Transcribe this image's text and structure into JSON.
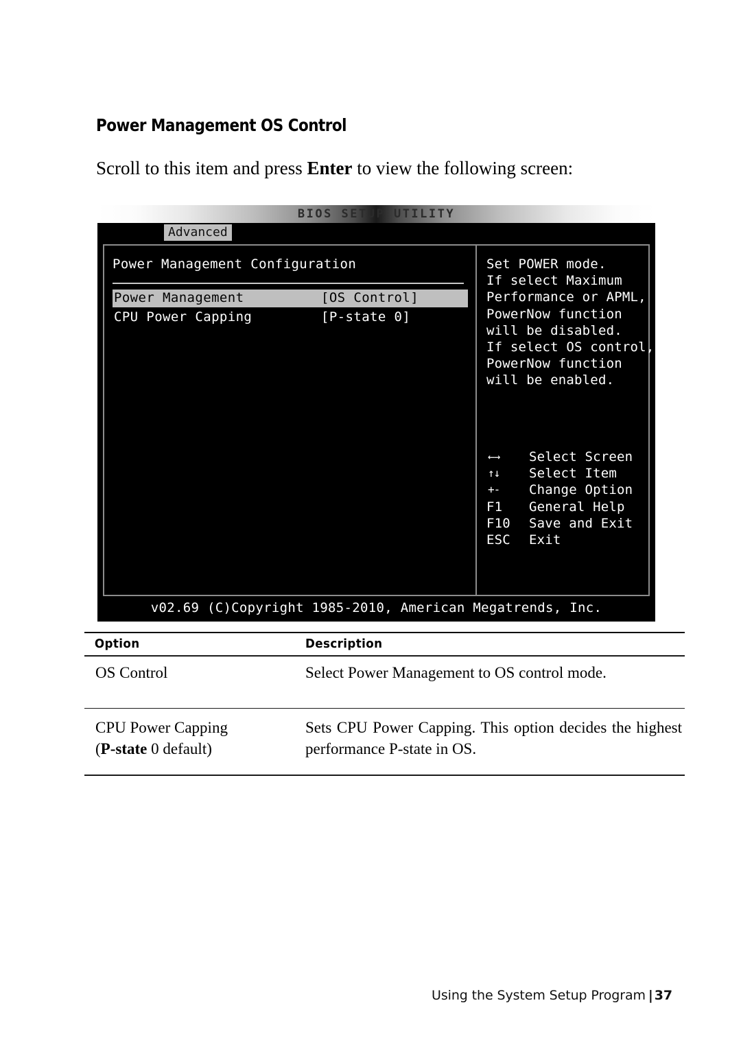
{
  "document": {
    "heading": "Power Management OS Control",
    "intro_prefix": "Scroll to this item and press ",
    "intro_bold": "Enter",
    "intro_suffix": " to view the following screen:"
  },
  "bios": {
    "title": "BIOS SETUP UTILITY",
    "active_tab": "Advanced",
    "config_title": "Power Management Configuration",
    "rows": [
      {
        "label": "Power Management",
        "value": "[OS Control]",
        "selected": true
      },
      {
        "label": "CPU Power Capping",
        "value": "[P-state 0]",
        "selected": false
      }
    ],
    "help_text": "Set POWER mode.\nIf select Maximum\nPerformance or APML,\nPowerNow function\nwill be disabled.\nIf select OS control,\nPowerNow function\nwill be enabled.",
    "keys": [
      {
        "key": "←→",
        "desc": "Select Screen",
        "symbol": true
      },
      {
        "key": "↑↓",
        "desc": "Select Item",
        "symbol": true
      },
      {
        "key": "+-",
        "desc": "Change Option",
        "symbol": true
      },
      {
        "key": "F1",
        "desc": "General Help",
        "symbol": false
      },
      {
        "key": "F10",
        "desc": "Save and Exit",
        "symbol": false
      },
      {
        "key": "ESC",
        "desc": "Exit",
        "symbol": false
      }
    ],
    "copyright": "v02.69 (C)Copyright 1985-2010, American Megatrends, Inc.",
    "colors": {
      "background": "#000000",
      "text": "#ffffff",
      "highlight": "#bfbfbf",
      "border": "#8c8c8c"
    }
  },
  "option_table": {
    "headers": {
      "option": "Option",
      "description": "Description"
    },
    "rows": [
      {
        "option": "OS Control",
        "description": "Select Power Management to OS control mode."
      },
      {
        "option_line1": "CPU Power Capping",
        "option_line2_open": "(",
        "option_line2_bold": "P-state",
        "option_line2_rest": " 0 default)",
        "description": "Sets CPU Power Capping. This option decides the highest performance P-state in OS."
      }
    ]
  },
  "footer": {
    "text": "Using the System Setup Program",
    "separator": "|",
    "page_number": "37"
  }
}
